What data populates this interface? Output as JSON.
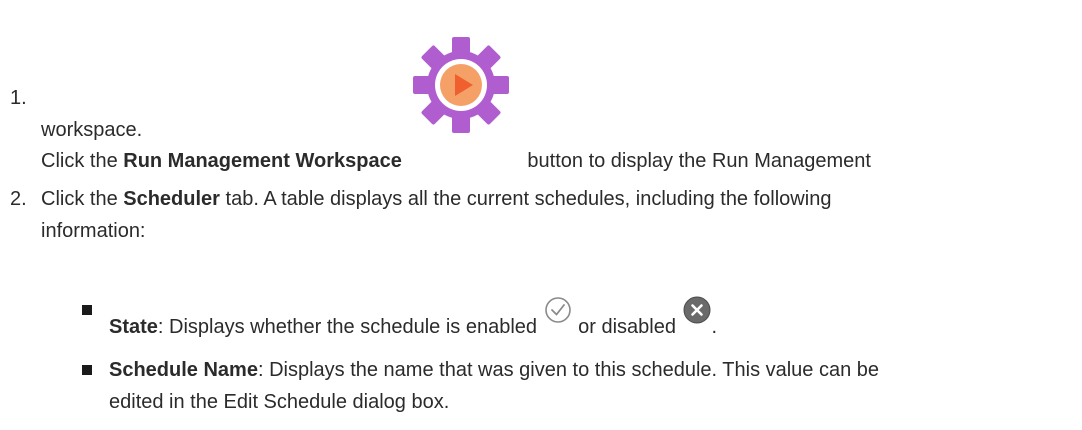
{
  "steps": [
    {
      "number": "1.",
      "pre": "Click the ",
      "bold": "Run Management Workspace",
      "post": " button to display the Run Management",
      "continuation": "workspace.",
      "icon": "run-management-workspace-icon"
    },
    {
      "number": "2.",
      "pre": "Click the ",
      "bold": "Scheduler",
      "post": " tab. A table displays all the current schedules, including the following",
      "continuation": "information:"
    }
  ],
  "bullets": [
    {
      "bold": "State",
      "text1": ": Displays whether the schedule is enabled ",
      "text2": " or disabled ",
      "text3": ".",
      "icons": [
        "enabled-check-icon",
        "disabled-x-icon"
      ]
    },
    {
      "bold": "Schedule Name",
      "text1": ": Displays the name that was given to this schedule. This value can be",
      "continuation": "edited in the Edit Schedule dialog box."
    }
  ],
  "colors": {
    "text": "#2b2b2b",
    "gear": "#b05ecf",
    "play_circle": "#f5a066",
    "play_triangle": "#f0602e"
  }
}
